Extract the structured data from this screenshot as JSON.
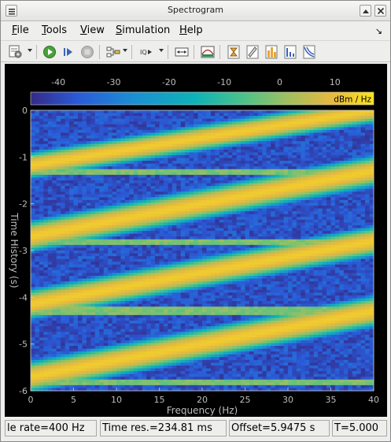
{
  "window": {
    "title": "Spectrogram"
  },
  "menu": {
    "items": [
      "File",
      "Tools",
      "View",
      "Simulation",
      "Help"
    ]
  },
  "toolbar": {
    "icons": [
      "settings-icon",
      "run-icon",
      "step-forward-icon",
      "stop-icon",
      "signal-config-icon",
      "zoom-options-icon",
      "scale-axes-icon",
      "spectrum-icon",
      "cursor-icon",
      "ruler-icon",
      "peak-finder-icon",
      "distortion-icon",
      "ccdf-icon"
    ]
  },
  "status": {
    "sample_rate": "le rate=400 Hz",
    "time_res": "Time res.=234.81 ms",
    "offset": "Offset=5.9475 s",
    "time": "T=5.000"
  },
  "chart_data": {
    "type": "heatmap",
    "colorbar": {
      "label": "dBm / Hz",
      "ticks": [
        -40,
        -30,
        -20,
        -10,
        0,
        10
      ],
      "range": [
        -45,
        17
      ]
    },
    "xlabel": "Frequency (Hz)",
    "ylabel": "Time History (s)",
    "xlim": [
      0,
      40
    ],
    "ylim": [
      0,
      -6
    ],
    "xticks": [
      0,
      5,
      10,
      15,
      20,
      25,
      30,
      35,
      40
    ],
    "yticks": [
      0,
      -1,
      -2,
      -3,
      -4,
      -5,
      -6
    ],
    "chirps": [
      {
        "t_start": -1.18,
        "t_end": 0,
        "f_start": 0,
        "f_end": 40
      },
      {
        "t_start": -2.7,
        "t_end": -1.3,
        "f_start": 0,
        "f_end": 40
      },
      {
        "t_start": -4.15,
        "t_end": -2.8,
        "f_start": 0,
        "f_end": 40
      },
      {
        "t_start": -5.7,
        "t_end": -4.3,
        "f_start": 0,
        "f_end": 40
      }
    ],
    "colormap": [
      "#352a87",
      "#2a5bd8",
      "#1b8fd3",
      "#0db3b8",
      "#4cc28a",
      "#a7bf5c",
      "#e8b93f",
      "#f9e41a"
    ],
    "background_level_db": -38,
    "peak_level_db": 12
  }
}
